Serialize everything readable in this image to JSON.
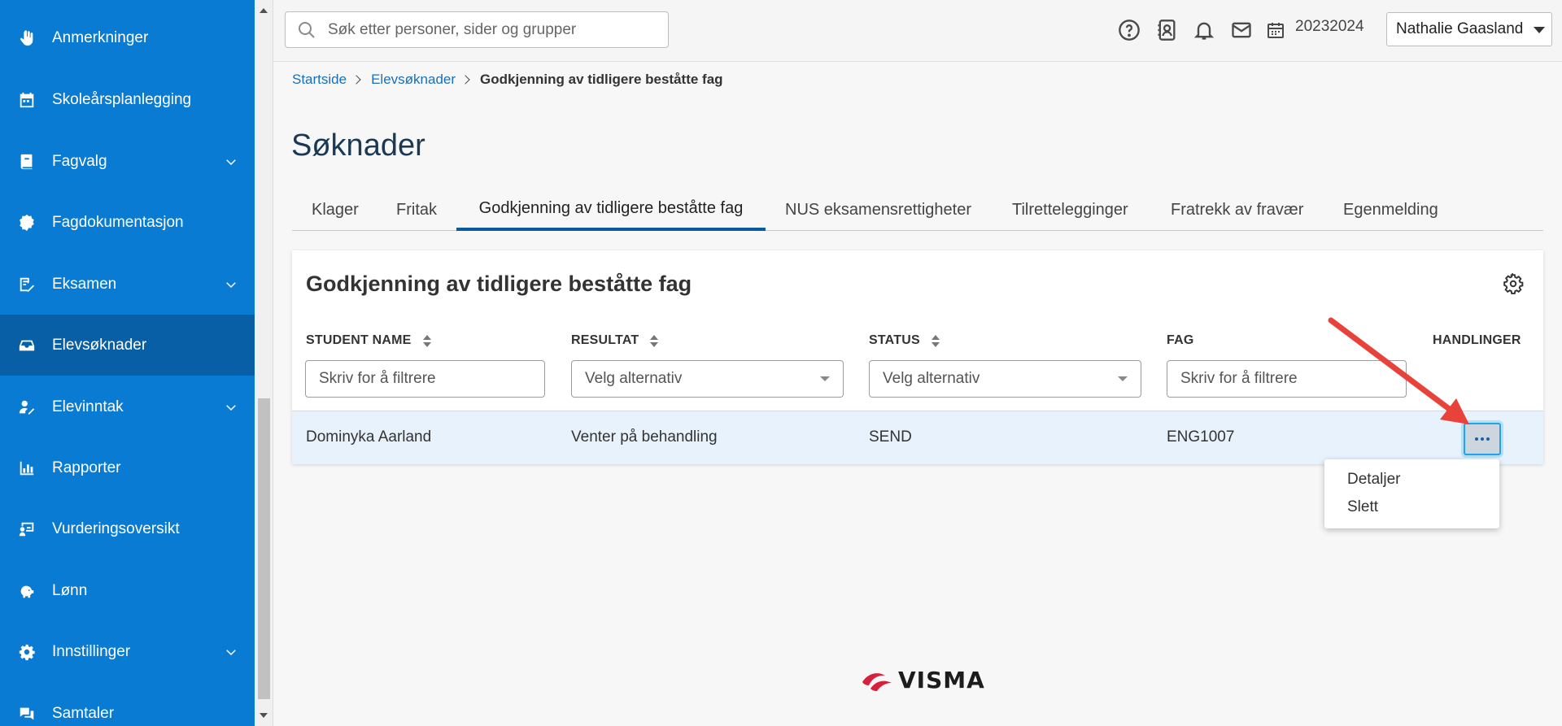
{
  "sidebar": {
    "items": [
      {
        "label": "Anmerkninger",
        "icon": "hand-icon",
        "chevron": false,
        "active": false
      },
      {
        "label": "Skoleårsplanlegging",
        "icon": "calendar-icon",
        "chevron": false,
        "active": false
      },
      {
        "label": "Fagvalg",
        "icon": "book-icon",
        "chevron": true,
        "active": false
      },
      {
        "label": "Fagdokumentasjon",
        "icon": "badge-icon",
        "chevron": false,
        "active": false
      },
      {
        "label": "Eksamen",
        "icon": "exam-icon",
        "chevron": true,
        "active": false
      },
      {
        "label": "Elevsøknader",
        "icon": "inbox-icon",
        "chevron": false,
        "active": true
      },
      {
        "label": "Elevinntak",
        "icon": "user-edit-icon",
        "chevron": true,
        "active": false
      },
      {
        "label": "Rapporter",
        "icon": "bar-chart-icon",
        "chevron": false,
        "active": false
      },
      {
        "label": "Vurderingsoversikt",
        "icon": "board-icon",
        "chevron": false,
        "active": false
      },
      {
        "label": "Lønn",
        "icon": "piggy-bank-icon",
        "chevron": false,
        "active": false
      },
      {
        "label": "Innstillinger",
        "icon": "gear-icon",
        "chevron": true,
        "active": false
      },
      {
        "label": "Samtaler",
        "icon": "chat-icon",
        "chevron": false,
        "active": false
      }
    ]
  },
  "topbar": {
    "search_placeholder": "Søk etter personer, sider og grupper",
    "year": "20232024",
    "user": "Nathalie Gaasland"
  },
  "breadcrumb": {
    "home": "Startside",
    "section": "Elevsøknader",
    "current": "Godkjenning av tidligere beståtte fag"
  },
  "page": {
    "title": "Søknader"
  },
  "tabs": [
    {
      "label": "Klager",
      "active": false
    },
    {
      "label": "Fritak",
      "active": false
    },
    {
      "label": "Godkjenning av tidligere beståtte fag",
      "active": true
    },
    {
      "label": "NUS eksamensrettigheter",
      "active": false
    },
    {
      "label": "Tilrettelegginger",
      "active": false
    },
    {
      "label": "Fratrekk av fravær",
      "active": false
    },
    {
      "label": "Egenmelding",
      "active": false
    }
  ],
  "card": {
    "title": "Godkjenning av tidligere beståtte fag",
    "columns": {
      "student_name": "STUDENT NAME",
      "resultat": "RESULTAT",
      "status": "STATUS",
      "fag": "FAG",
      "handlinger": "HANDLINGER"
    },
    "filters": {
      "student_name": "Skriv for å filtrere",
      "resultat": "Velg alternativ",
      "status": "Velg alternativ",
      "fag": "Skriv for å filtrere"
    },
    "rows": [
      {
        "student_name": "Dominyka Aarland",
        "resultat": "Venter på behandling",
        "status": "SEND",
        "fag": "ENG1007"
      }
    ]
  },
  "menu": {
    "items": [
      "Detaljer",
      "Slett"
    ]
  },
  "logo": {
    "text": "VISMA"
  },
  "colors": {
    "sidebar": "#0a7bd2",
    "sidebar_active": "#085fa6",
    "accent": "#0b5aa0",
    "annotation_arrow": "#e8423a",
    "logo_red": "#d6203c"
  }
}
